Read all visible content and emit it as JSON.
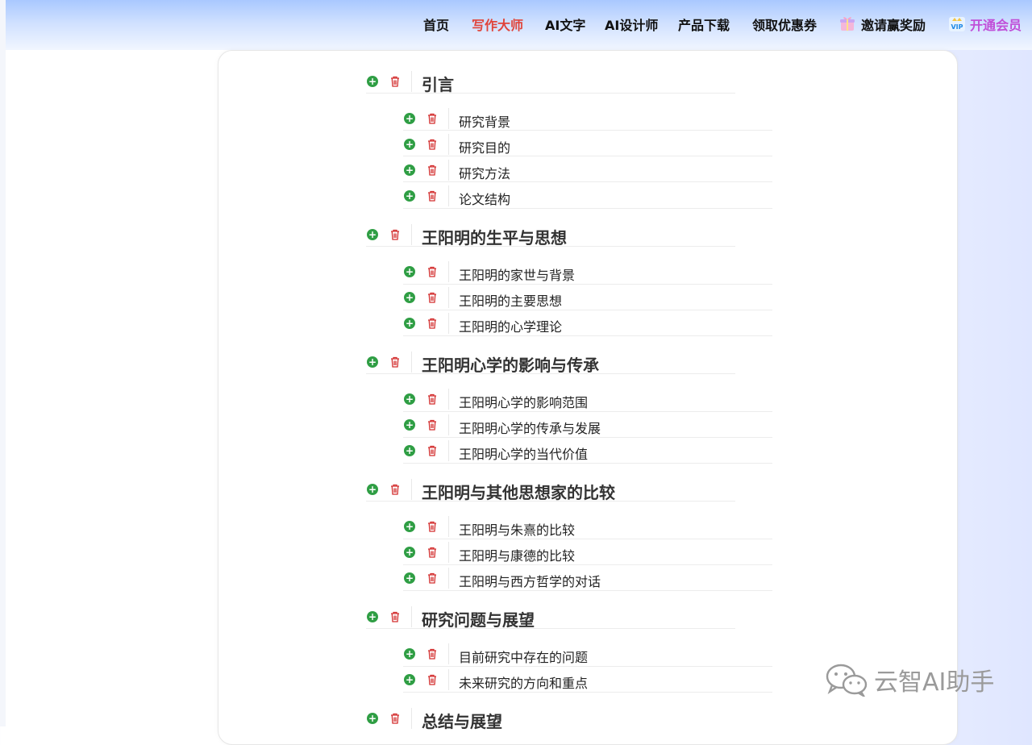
{
  "nav": {
    "items": [
      "首页",
      "写作大师",
      "AI文字",
      "AI设计师",
      "产品下载",
      "领取优惠券",
      "邀请赢奖励",
      "开通会员"
    ],
    "active": "写作大师",
    "gift_icon": "gift-icon",
    "vip_icon": "vip-icon"
  },
  "outline": [
    {
      "title": "引言",
      "children": [
        "研究背景",
        "研究目的",
        "研究方法",
        "论文结构"
      ]
    },
    {
      "title": "王阳明的生平与思想",
      "children": [
        "王阳明的家世与背景",
        "王阳明的主要思想",
        "王阳明的心学理论"
      ]
    },
    {
      "title": "王阳明心学的影响与传承",
      "children": [
        "王阳明心学的影响范围",
        "王阳明心学的传承与发展",
        "王阳明心学的当代价值"
      ]
    },
    {
      "title": "王阳明与其他思想家的比较",
      "children": [
        "王阳明与朱熹的比较",
        "王阳明与康德的比较",
        "王阳明与西方哲学的对话"
      ]
    },
    {
      "title": "研究问题与展望",
      "children": [
        "目前研究中存在的问题",
        "未来研究的方向和重点"
      ]
    },
    {
      "title": "总结与展望",
      "children": []
    }
  ],
  "watermark": {
    "text": "云智AI助手",
    "icon": "wechat-icon"
  },
  "colors": {
    "accent_red": "#e0443a",
    "add_green": "#2f9e44",
    "delete_red": "#d32f2f",
    "vip_purple": "#c04fd8"
  }
}
